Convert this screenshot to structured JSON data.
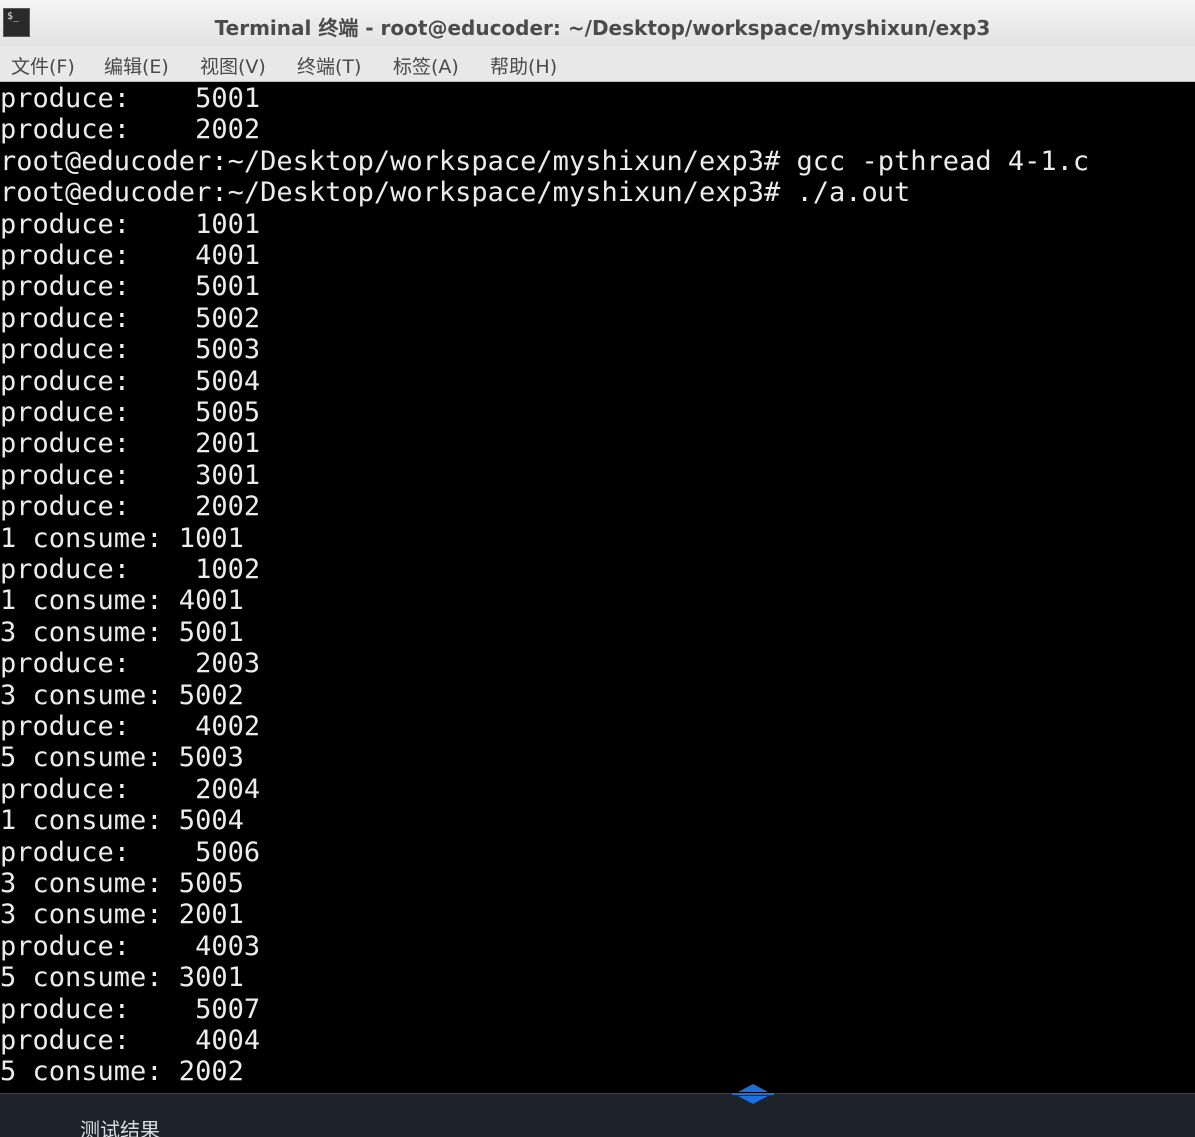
{
  "window": {
    "title": "Terminal 终端 - root@educoder: ~/Desktop/workspace/myshixun/exp3",
    "icon_text": "$_"
  },
  "menu": [
    "文件(F)",
    "编辑(E)",
    "视图(V)",
    "终端(T)",
    "标签(A)",
    "帮助(H)"
  ],
  "terminal": {
    "lines": [
      "produce:    5001",
      "produce:    2002",
      "root@educoder:~/Desktop/workspace/myshixun/exp3# gcc -pthread 4-1.c",
      "root@educoder:~/Desktop/workspace/myshixun/exp3# ./a.out",
      "produce:    1001",
      "produce:    4001",
      "produce:    5001",
      "produce:    5002",
      "produce:    5003",
      "produce:    5004",
      "produce:    5005",
      "produce:    2001",
      "produce:    3001",
      "produce:    2002",
      "1 consume: 1001",
      "produce:    1002",
      "1 consume: 4001",
      "3 consume: 5001",
      "produce:    2003",
      "3 consume: 5002",
      "produce:    4002",
      "5 consume: 5003",
      "produce:    2004",
      "1 consume: 5004",
      "produce:    5006",
      "3 consume: 5005",
      "3 consume: 2001",
      "produce:    4003",
      "5 consume: 3001",
      "produce:    5007",
      "produce:    4004",
      "5 consume: 2002"
    ]
  },
  "bottom_panel": {
    "label": "测试结果"
  },
  "colors": {
    "terminal_bg": "#000000",
    "terminal_fg": "#ececec",
    "titlebar_bg": "#e8e8e8",
    "panel_bg": "#1e232b",
    "handle_blue": "#1e6fd9"
  },
  "icons": {
    "app": "terminal-icon",
    "resize": "resize-handle-icon"
  }
}
